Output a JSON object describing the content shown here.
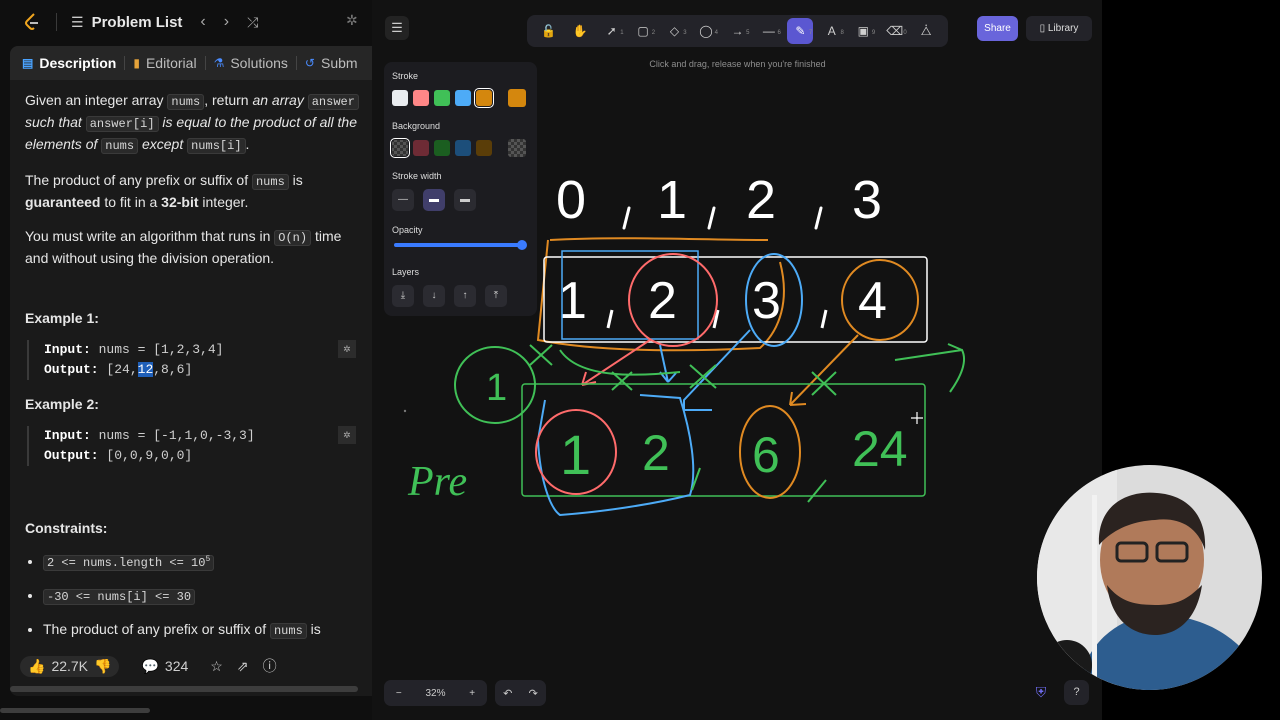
{
  "left_panel": {
    "title": "Problem List",
    "tabs": [
      "Description",
      "Editorial",
      "Solutions",
      "Subm"
    ],
    "description": {
      "p1_a": "Given an integer array ",
      "p1_nums": "nums",
      "p1_b": ", return ",
      "p1_c": "an array",
      "p1_answer": "answer",
      "p1_d": "such that ",
      "p1_answer_i": "answer[i]",
      "p1_e": " is equal to the product of all the elements of ",
      "p1_f": " except ",
      "p1_nums_i": "nums[i]",
      "p1_g": ".",
      "p2_a": "The product of any prefix or suffix of ",
      "p2_b": " is ",
      "p2_guar": "guaranteed",
      "p2_c": " to fit in a ",
      "p2_bits": "32-bit",
      "p2_d": " integer.",
      "p3_a": "You must write an algorithm that runs in ",
      "p3_on": "O(n)",
      "p3_b": " time and without using the division operation."
    },
    "example1": {
      "heading": "Example 1:",
      "input_label": "Input:",
      "input": "nums = [1,2,3,4]",
      "output_label": "Output:",
      "output_pre": "[24,",
      "output_hl": "12",
      "output_post": ",8,6]"
    },
    "example2": {
      "heading": "Example 2:",
      "input_label": "Input:",
      "input": "nums = [-1,1,0,-3,3]",
      "output_label": "Output:",
      "output": "[0,0,9,0,0]"
    },
    "constraints": {
      "heading": "Constraints:",
      "c1": "2 <= nums.length <= 10",
      "c1_exp": "5",
      "c2": "-30 <= nums[i] <= 30",
      "c3_a": "The product of any prefix or suffix of ",
      "c3_nums": "nums",
      "c3_b": " is"
    },
    "footer": {
      "likes": "22.7K",
      "comments": "324"
    }
  },
  "whiteboard": {
    "hint": "Click and drag, release when you're finished",
    "share": "Share",
    "library": "Library",
    "zoom": "32%",
    "props": {
      "stroke": "Stroke",
      "background": "Background",
      "stroke_width": "Stroke width",
      "opacity": "Opacity",
      "opacity_value": 1.0,
      "layers": "Layers"
    },
    "stroke_colors": [
      "#e9ecef",
      "#ff8787",
      "#40c057",
      "#4dabf7",
      "#d4870e"
    ],
    "background_colors": [
      "#343a40",
      "#6e2b35",
      "#1b5e20",
      "#1c4e7a",
      "#5a3d08"
    ],
    "tools": [
      {
        "icon": "lock-icon",
        "glyph": "🔓",
        "key": ""
      },
      {
        "icon": "hand-icon",
        "glyph": "✋",
        "key": ""
      },
      {
        "icon": "select-icon",
        "glyph": "➚",
        "key": "1"
      },
      {
        "icon": "rectangle-icon",
        "glyph": "▢",
        "key": "2"
      },
      {
        "icon": "diamond-icon",
        "glyph": "◇",
        "key": "3"
      },
      {
        "icon": "ellipse-icon",
        "glyph": "◯",
        "key": "4"
      },
      {
        "icon": "arrow-icon",
        "glyph": "→",
        "key": "5"
      },
      {
        "icon": "line-icon",
        "glyph": "—",
        "key": "6"
      },
      {
        "icon": "pencil-icon",
        "glyph": "✎",
        "key": "7"
      },
      {
        "icon": "text-icon",
        "glyph": "A",
        "key": "8"
      },
      {
        "icon": "image-icon",
        "glyph": "▣",
        "key": "9"
      },
      {
        "icon": "eraser-icon",
        "glyph": "⌫",
        "key": "0"
      },
      {
        "icon": "ai-tools-icon",
        "glyph": "⧊",
        "key": ""
      }
    ],
    "drawing": {
      "indices": [
        "0",
        "1",
        "2",
        "3"
      ],
      "inputs": [
        "1",
        "2",
        "3",
        "4"
      ],
      "prefix": [
        "1",
        "2",
        "6",
        "24"
      ],
      "prefix_label": "Pre"
    }
  }
}
